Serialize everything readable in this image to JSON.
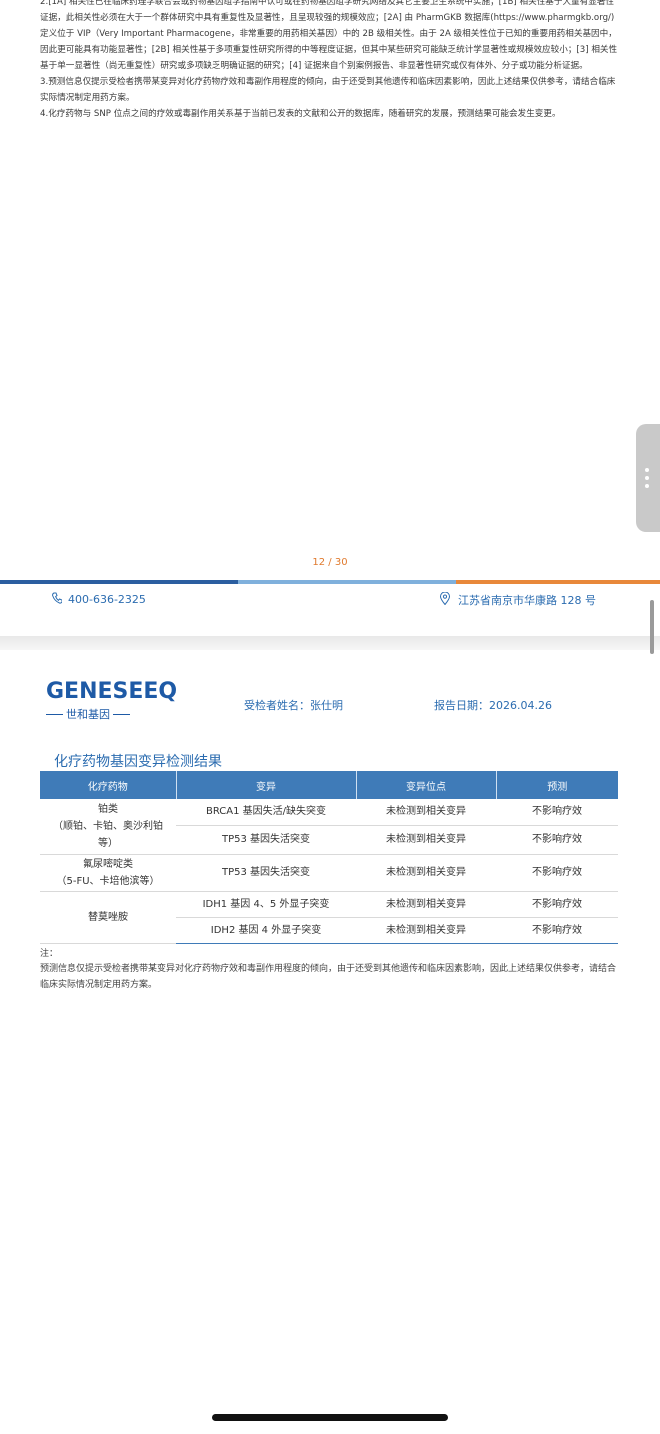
{
  "previous_page": {
    "notes": [
      "2.[1A] 相关性已在临床药理学联合会或药物基因组学指南中认可或在药物基因组学研究网络及其它主要卫生系统中实施；[1B] 相关性基于大量有显著性证据，此相关性必须在大于一个群体研究中具有重复性及显著性，且呈现较强的规模效应；[2A] 由 PharmGKB 数据库(https://www.pharmgkb.org/)定义位于 VIP（Very Important Pharmacogene，非常重要的用药相关基因）中的 2B 级相关性。由于 2A 级相关性位于已知的重要用药相关基因中，因此更可能具有功能显著性；[2B] 相关性基于多项重复性研究所得的中等程度证据，但其中某些研究可能缺乏统计学显著性或规模效应较小；[3] 相关性基于单一显著性（尚无重复性）研究或多项缺乏明确证据的研究；[4] 证据来自个别案例报告、非显著性研究或仅有体外、分子或功能分析证据。",
      "3.预测信息仅提示受检者携带某变异对化疗药物疗效和毒副作用程度的倾向，由于还受到其他遗传和临床因素影响，因此上述结果仅供参考，请结合临床实际情况制定用药方案。",
      "4.化疗药物与 SNP 位点之间的疗效或毒副作用关系基于当前已发表的文献和公开的数据库，随着研究的发展，预测结果可能会发生变更。"
    ],
    "page_number": "12 / 30",
    "phone": "400-636-2325",
    "address": "江苏省南京市华康路 128 号"
  },
  "bar_colors": [
    "#2b5ea0",
    "#7fb0dc",
    "#e8883a"
  ],
  "header": {
    "logo_text": "GENESEEQ",
    "logo_sub": "世和基因",
    "patient_label": "受检者姓名：张仕明",
    "report_date_label": "报告日期：2026.04.26"
  },
  "section_title": "化疗药物基因变异检测结果",
  "table": {
    "headers": [
      "化疗药物",
      "变异",
      "变异位点",
      "预测"
    ],
    "groups": [
      {
        "drug": [
          "铂类",
          "（顺铂、卡铂、奥沙利铂",
          "等）"
        ],
        "rows": [
          {
            "variant": "BRCA1 基因失活/缺失突变",
            "site": "未检测到相关变异",
            "prediction": "不影响疗效"
          },
          {
            "variant": "TP53 基因失活突变",
            "site": "未检测到相关变异",
            "prediction": "不影响疗效"
          }
        ]
      },
      {
        "drug": [
          "氟尿嘧啶类",
          "（5-FU、卡培他滨等）"
        ],
        "rows": [
          {
            "variant": "TP53 基因失活突变",
            "site": "未检测到相关变异",
            "prediction": "不影响疗效"
          }
        ]
      },
      {
        "drug": [
          "替莫唑胺"
        ],
        "rows": [
          {
            "variant": "IDH1 基因 4、5 外显子突变",
            "site": "未检测到相关变异",
            "prediction": "不影响疗效"
          },
          {
            "variant": "IDH2 基因 4 外显子突变",
            "site": "未检测到相关变异",
            "prediction": "不影响疗效"
          }
        ]
      }
    ]
  },
  "note_label": "注：",
  "note_text": "预测信息仅提示受检者携带某变异对化疗药物疗效和毒副作用程度的倾向，由于还受到其他遗传和临床因素影响，因此上述结果仅供参考，请结合临床实际情况制定用药方案。"
}
